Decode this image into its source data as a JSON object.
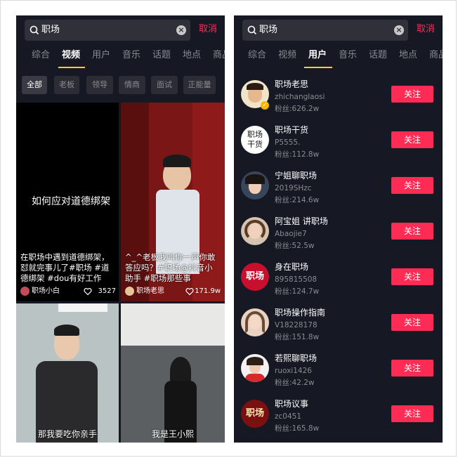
{
  "left": {
    "search": {
      "query": "职场",
      "cancel_label": "取消"
    },
    "tabs": [
      "综合",
      "视频",
      "用户",
      "音乐",
      "话题",
      "地点",
      "商品"
    ],
    "active_tab": "视频",
    "filters": [
      "全部",
      "老板",
      "领导",
      "情商",
      "面试",
      "正能量"
    ],
    "videos": [
      {
        "overlay_title": "如何应对道德绑架",
        "caption": "在职场中遇到道德绑架，怼就完事儿了#职场 #道德绑架 #dou有好工作",
        "author": "职场小白",
        "likes": "3527"
      },
      {
        "caption": "^_^老板我叫你一声你敢答应吗？#职场@抖音小助手 #职场那些事",
        "author": "职场老思",
        "likes": "171.9w"
      },
      {
        "subtitle": "那我要吃你亲手"
      },
      {
        "subtitle": "我是王小熙"
      }
    ]
  },
  "right": {
    "search": {
      "query": "职场",
      "cancel_label": "取消"
    },
    "tabs": [
      "综合",
      "视频",
      "用户",
      "音乐",
      "话题",
      "地点",
      "商品"
    ],
    "active_tab": "用户",
    "follow_label": "关注",
    "users": [
      {
        "name": "职场老思",
        "id": "zhichanglaosi",
        "fans": "粉丝:626.2w"
      },
      {
        "name": "职场干货",
        "id": "P5555.",
        "fans": "粉丝:112.8w",
        "avatar_text": "职场干货"
      },
      {
        "name": "宁姐聊职场",
        "id": "2019SHzc",
        "fans": "粉丝:214.6w"
      },
      {
        "name": "阿宝姐 讲职场",
        "id": "Abaojie7",
        "fans": "粉丝:52.5w"
      },
      {
        "name": "身在职场",
        "id": "895815508",
        "fans": "粉丝:124.7w",
        "avatar_text": "职场"
      },
      {
        "name": "职场操作指南",
        "id": "V18228178",
        "fans": "粉丝:151.8w"
      },
      {
        "name": "若熙聊职场",
        "id": "ruoxi1426",
        "fans": "粉丝:42.2w"
      },
      {
        "name": "职场议事",
        "id": "zc0451",
        "fans": "粉丝:165.8w",
        "avatar_text": "职场"
      }
    ]
  },
  "colors": {
    "background": "#161823",
    "accent": "#fe2c55",
    "tab_indicator": "#facf2c",
    "muted_text": "#8a8b91"
  }
}
